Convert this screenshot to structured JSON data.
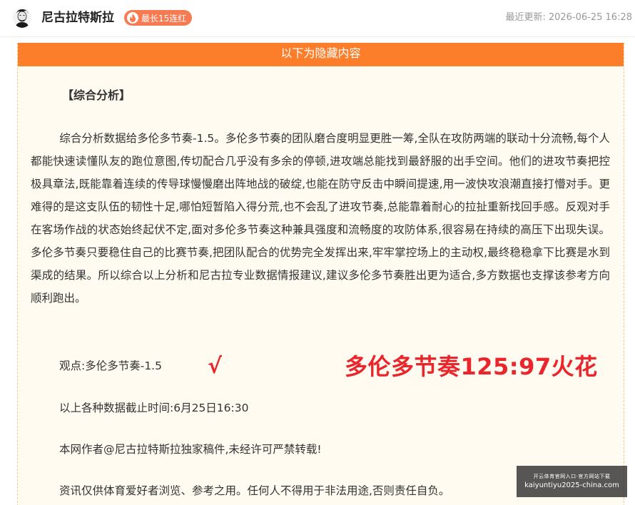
{
  "header": {
    "author_name": "尼古拉特斯拉",
    "streak_badge": "最长15连红",
    "update_label": "最近更新:",
    "update_time": "2026-06-25 16:28"
  },
  "hidden_banner": "以下为隐藏内容",
  "article": {
    "section_title": "【综合分析】",
    "analysis": "综合分析数据给多伦多节奏-1.5。多伦多节奏的团队磨合度明显更胜一筹,全队在攻防两端的联动十分流畅,每个人都能快速读懂队友的跑位意图,传切配合几乎没有多余的停顿,进攻端总能找到最舒服的出手空间。他们的进攻节奏把控极具章法,既能靠着连续的传导球慢慢磨出阵地战的破绽,也能在防守反击中瞬间提速,用一波快攻浪潮直接打懵对手。更难得的是这支队伍的韧性十足,哪怕短暂陷入得分荒,也不会乱了进攻节奏,总能靠着耐心的拉扯重新找回手感。反观对手在客场作战的状态始终起伏不定,面对多伦多节奏这种兼具强度和流畅度的攻防体系,很容易在持续的高压下出现失误。多伦多节奏只要稳住自己的比赛节奏,把团队配合的优势完全发挥出来,牢牢掌控场上的主动权,最终稳稳拿下比赛是水到渠成的结果。所以综合以上分析和尼古拉专业数据情报建议,建议多伦多节奏胜出更为适合,多方数据也支撑该参考方向顺利跑出。",
    "viewpoint": "观点:多伦多节奏-1.5",
    "checkmark": "√",
    "result_stamp": "多伦多节奏125:97火花",
    "cutoff": "以上各种数据截止时间:6月25日16:30",
    "copyright": "本网作者@尼古拉特斯拉独家稿件,未经许可严禁转载!",
    "disclaimer": "资讯仅供体育爱好者浏览、参考之用。任何人不得用于非法用途,否则责任自负。"
  },
  "watermark": {
    "line1": "开云体育官网入口·官方网站下载",
    "line2": "kaiyuntiyu2025-china.com"
  },
  "colors": {
    "accent_orange": "#fc7e2a",
    "badge_orange": "#f77b52",
    "stamp_red": "#e8262c",
    "box_bg": "#fffbf1"
  },
  "icons": {
    "avatar": "portrait-avatar",
    "badge": "flame-icon"
  }
}
